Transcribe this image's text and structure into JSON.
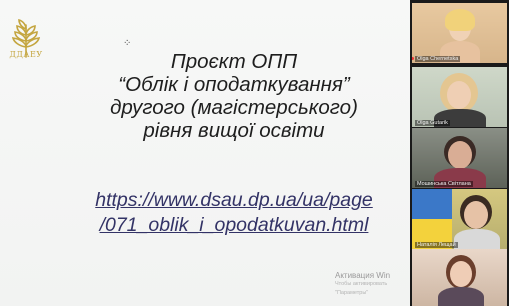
{
  "slide": {
    "logo_text": "ДДАЕУ",
    "title_lines": [
      "Проєкт ОПП",
      "“Облік і оподаткування”",
      "другого (магістерського)",
      "рівня вищої освіти"
    ],
    "link_lines": [
      "https://www.dsau.dp.ua/ua/page",
      "/071_oblik_i_opodatkuvan.html"
    ],
    "activation": {
      "line1": "Активация Win",
      "line2": "Чтобы активировать",
      "line3": "\"Параметры\""
    }
  },
  "participants": [
    {
      "name": "Olga Chernetska",
      "muted": true
    },
    {
      "name": "Olga Gutarik",
      "muted": false
    },
    {
      "name": "Мошинська Світлана",
      "muted": false
    },
    {
      "name": "Наталія Лещай",
      "muted": false
    },
    {
      "name": "",
      "muted": false
    }
  ],
  "colors": {
    "logo_gold": "#c4a640",
    "title_text": "#1e1e1e",
    "link_text": "#333366",
    "strip_bg": "#1a1a1a",
    "mic_muted": "#e33333"
  }
}
